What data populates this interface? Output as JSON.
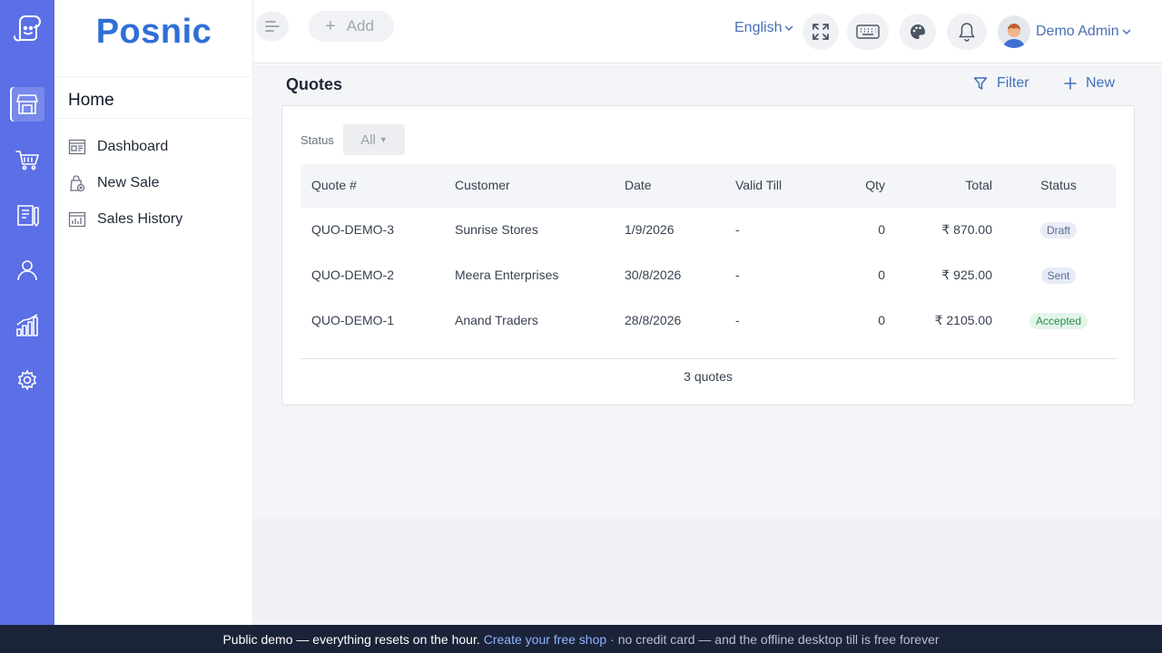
{
  "brand": "Posnic",
  "sidebar": {
    "section_title": "Home",
    "items": [
      {
        "label": "Dashboard",
        "icon": "dashboard-icon"
      },
      {
        "label": "New Sale",
        "icon": "new-sale-icon"
      },
      {
        "label": "Sales History",
        "icon": "sales-history-icon"
      }
    ]
  },
  "rail": {
    "icons": [
      "store-icon",
      "cart-icon",
      "clipboard-icon",
      "user-icon",
      "analytics-icon",
      "settings-icon"
    ]
  },
  "topbar": {
    "add_label": "Add",
    "language": "English",
    "user_name": "Demo Admin"
  },
  "page": {
    "title": "Quotes",
    "filter_label": "Filter",
    "new_label": "New"
  },
  "filters": {
    "status_label": "Status",
    "status_value": "All"
  },
  "table": {
    "headers": [
      "Quote #",
      "Customer",
      "Date",
      "Valid Till",
      "Qty",
      "Total",
      "Status"
    ],
    "rows": [
      {
        "quote": "QUO-DEMO-3",
        "customer": "Sunrise Stores",
        "date": "1/9/2026",
        "valid_till": "-",
        "qty": "0",
        "total": "₹ 870.00",
        "status": "Draft"
      },
      {
        "quote": "QUO-DEMO-2",
        "customer": "Meera Enterprises",
        "date": "30/8/2026",
        "valid_till": "-",
        "qty": "0",
        "total": "₹ 925.00",
        "status": "Sent"
      },
      {
        "quote": "QUO-DEMO-1",
        "customer": "Anand Traders",
        "date": "28/8/2026",
        "valid_till": "-",
        "qty": "0",
        "total": "₹ 2105.00",
        "status": "Accepted"
      }
    ],
    "count_text": "3 quotes"
  },
  "banner": {
    "text": "Public demo — everything resets on the hour.",
    "link": "Create your free shop",
    "suffix": "· no credit card — and the offline desktop till is free forever"
  },
  "colors": {
    "rail": "#5b6fe6",
    "brand": "#2f6fd6",
    "accent": "#3e6fb8",
    "banner": "#1b2338"
  }
}
